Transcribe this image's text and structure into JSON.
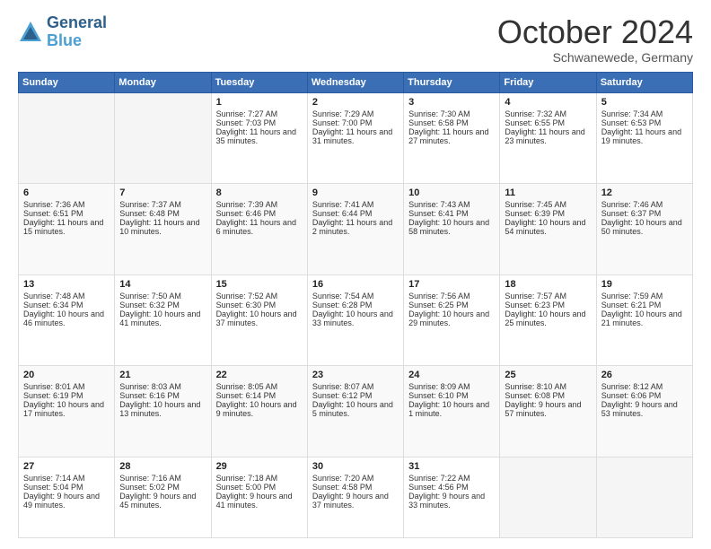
{
  "header": {
    "logo_line1": "General",
    "logo_line2": "Blue",
    "month": "October 2024",
    "location": "Schwanewede, Germany"
  },
  "weekdays": [
    "Sunday",
    "Monday",
    "Tuesday",
    "Wednesday",
    "Thursday",
    "Friday",
    "Saturday"
  ],
  "weeks": [
    [
      {
        "day": "",
        "sunrise": "",
        "sunset": "",
        "daylight": ""
      },
      {
        "day": "",
        "sunrise": "",
        "sunset": "",
        "daylight": ""
      },
      {
        "day": "1",
        "sunrise": "Sunrise: 7:27 AM",
        "sunset": "Sunset: 7:03 PM",
        "daylight": "Daylight: 11 hours and 35 minutes."
      },
      {
        "day": "2",
        "sunrise": "Sunrise: 7:29 AM",
        "sunset": "Sunset: 7:00 PM",
        "daylight": "Daylight: 11 hours and 31 minutes."
      },
      {
        "day": "3",
        "sunrise": "Sunrise: 7:30 AM",
        "sunset": "Sunset: 6:58 PM",
        "daylight": "Daylight: 11 hours and 27 minutes."
      },
      {
        "day": "4",
        "sunrise": "Sunrise: 7:32 AM",
        "sunset": "Sunset: 6:55 PM",
        "daylight": "Daylight: 11 hours and 23 minutes."
      },
      {
        "day": "5",
        "sunrise": "Sunrise: 7:34 AM",
        "sunset": "Sunset: 6:53 PM",
        "daylight": "Daylight: 11 hours and 19 minutes."
      }
    ],
    [
      {
        "day": "6",
        "sunrise": "Sunrise: 7:36 AM",
        "sunset": "Sunset: 6:51 PM",
        "daylight": "Daylight: 11 hours and 15 minutes."
      },
      {
        "day": "7",
        "sunrise": "Sunrise: 7:37 AM",
        "sunset": "Sunset: 6:48 PM",
        "daylight": "Daylight: 11 hours and 10 minutes."
      },
      {
        "day": "8",
        "sunrise": "Sunrise: 7:39 AM",
        "sunset": "Sunset: 6:46 PM",
        "daylight": "Daylight: 11 hours and 6 minutes."
      },
      {
        "day": "9",
        "sunrise": "Sunrise: 7:41 AM",
        "sunset": "Sunset: 6:44 PM",
        "daylight": "Daylight: 11 hours and 2 minutes."
      },
      {
        "day": "10",
        "sunrise": "Sunrise: 7:43 AM",
        "sunset": "Sunset: 6:41 PM",
        "daylight": "Daylight: 10 hours and 58 minutes."
      },
      {
        "day": "11",
        "sunrise": "Sunrise: 7:45 AM",
        "sunset": "Sunset: 6:39 PM",
        "daylight": "Daylight: 10 hours and 54 minutes."
      },
      {
        "day": "12",
        "sunrise": "Sunrise: 7:46 AM",
        "sunset": "Sunset: 6:37 PM",
        "daylight": "Daylight: 10 hours and 50 minutes."
      }
    ],
    [
      {
        "day": "13",
        "sunrise": "Sunrise: 7:48 AM",
        "sunset": "Sunset: 6:34 PM",
        "daylight": "Daylight: 10 hours and 46 minutes."
      },
      {
        "day": "14",
        "sunrise": "Sunrise: 7:50 AM",
        "sunset": "Sunset: 6:32 PM",
        "daylight": "Daylight: 10 hours and 41 minutes."
      },
      {
        "day": "15",
        "sunrise": "Sunrise: 7:52 AM",
        "sunset": "Sunset: 6:30 PM",
        "daylight": "Daylight: 10 hours and 37 minutes."
      },
      {
        "day": "16",
        "sunrise": "Sunrise: 7:54 AM",
        "sunset": "Sunset: 6:28 PM",
        "daylight": "Daylight: 10 hours and 33 minutes."
      },
      {
        "day": "17",
        "sunrise": "Sunrise: 7:56 AM",
        "sunset": "Sunset: 6:25 PM",
        "daylight": "Daylight: 10 hours and 29 minutes."
      },
      {
        "day": "18",
        "sunrise": "Sunrise: 7:57 AM",
        "sunset": "Sunset: 6:23 PM",
        "daylight": "Daylight: 10 hours and 25 minutes."
      },
      {
        "day": "19",
        "sunrise": "Sunrise: 7:59 AM",
        "sunset": "Sunset: 6:21 PM",
        "daylight": "Daylight: 10 hours and 21 minutes."
      }
    ],
    [
      {
        "day": "20",
        "sunrise": "Sunrise: 8:01 AM",
        "sunset": "Sunset: 6:19 PM",
        "daylight": "Daylight: 10 hours and 17 minutes."
      },
      {
        "day": "21",
        "sunrise": "Sunrise: 8:03 AM",
        "sunset": "Sunset: 6:16 PM",
        "daylight": "Daylight: 10 hours and 13 minutes."
      },
      {
        "day": "22",
        "sunrise": "Sunrise: 8:05 AM",
        "sunset": "Sunset: 6:14 PM",
        "daylight": "Daylight: 10 hours and 9 minutes."
      },
      {
        "day": "23",
        "sunrise": "Sunrise: 8:07 AM",
        "sunset": "Sunset: 6:12 PM",
        "daylight": "Daylight: 10 hours and 5 minutes."
      },
      {
        "day": "24",
        "sunrise": "Sunrise: 8:09 AM",
        "sunset": "Sunset: 6:10 PM",
        "daylight": "Daylight: 10 hours and 1 minute."
      },
      {
        "day": "25",
        "sunrise": "Sunrise: 8:10 AM",
        "sunset": "Sunset: 6:08 PM",
        "daylight": "Daylight: 9 hours and 57 minutes."
      },
      {
        "day": "26",
        "sunrise": "Sunrise: 8:12 AM",
        "sunset": "Sunset: 6:06 PM",
        "daylight": "Daylight: 9 hours and 53 minutes."
      }
    ],
    [
      {
        "day": "27",
        "sunrise": "Sunrise: 7:14 AM",
        "sunset": "Sunset: 5:04 PM",
        "daylight": "Daylight: 9 hours and 49 minutes."
      },
      {
        "day": "28",
        "sunrise": "Sunrise: 7:16 AM",
        "sunset": "Sunset: 5:02 PM",
        "daylight": "Daylight: 9 hours and 45 minutes."
      },
      {
        "day": "29",
        "sunrise": "Sunrise: 7:18 AM",
        "sunset": "Sunset: 5:00 PM",
        "daylight": "Daylight: 9 hours and 41 minutes."
      },
      {
        "day": "30",
        "sunrise": "Sunrise: 7:20 AM",
        "sunset": "Sunset: 4:58 PM",
        "daylight": "Daylight: 9 hours and 37 minutes."
      },
      {
        "day": "31",
        "sunrise": "Sunrise: 7:22 AM",
        "sunset": "Sunset: 4:56 PM",
        "daylight": "Daylight: 9 hours and 33 minutes."
      },
      {
        "day": "",
        "sunrise": "",
        "sunset": "",
        "daylight": ""
      },
      {
        "day": "",
        "sunrise": "",
        "sunset": "",
        "daylight": ""
      }
    ]
  ]
}
